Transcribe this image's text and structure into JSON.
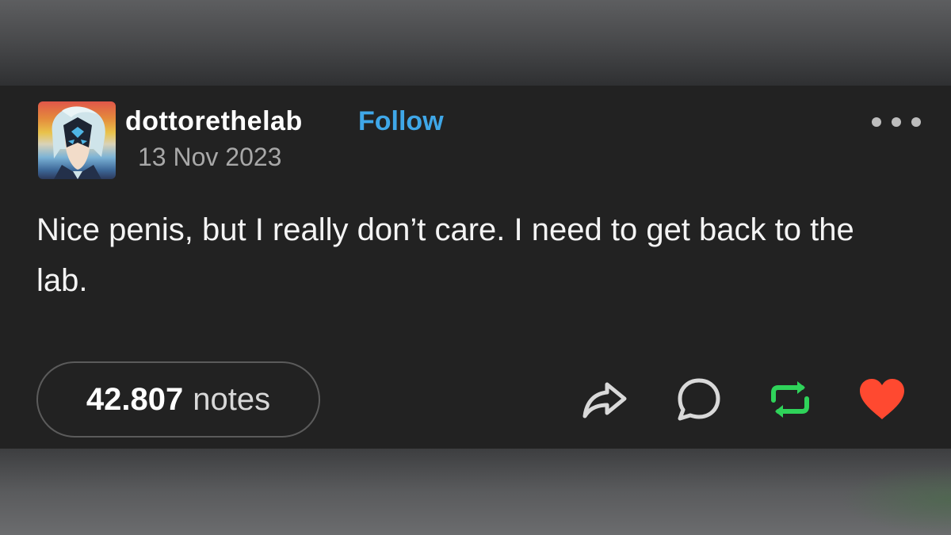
{
  "post": {
    "username": "dottorethelab",
    "follow_label": "Follow",
    "date": "13 Nov 2023",
    "body": "Nice penis, but I really don’t care. I need to get back to the lab.",
    "notes_count": "42.807",
    "notes_label": "notes"
  },
  "icons": {
    "more": "more-options-icon",
    "share": "share-icon",
    "reply": "reply-icon",
    "reblog": "reblog-icon",
    "like": "like-icon"
  },
  "colors": {
    "follow": "#3fa7e8",
    "reblog": "#2fd35a",
    "like": "#ff4930",
    "background": "#222222"
  }
}
